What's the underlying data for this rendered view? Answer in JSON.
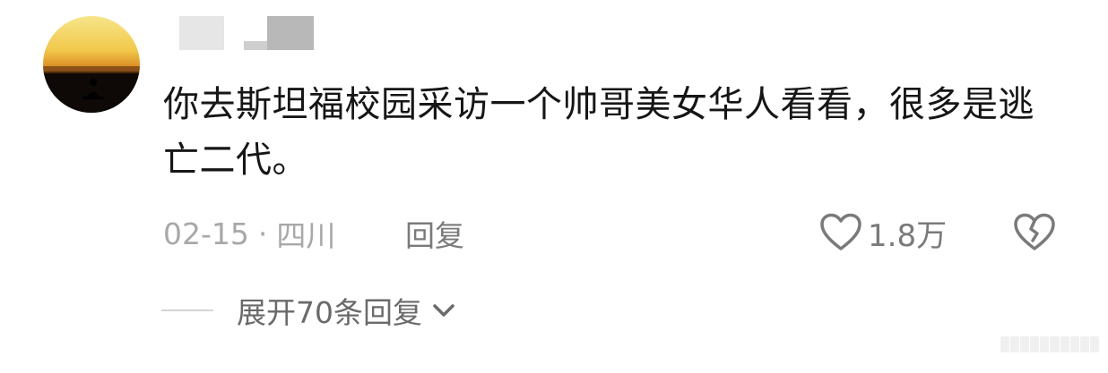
{
  "comment": {
    "text": "你去斯坦福校园采访一个帅哥美女华人看看，很多是逃亡二代。",
    "date": "02-15",
    "separator": "·",
    "location": "四川",
    "reply_label": "回复",
    "like_count": "1.8万",
    "expand_replies_label": "展开70条回复"
  },
  "icons": {
    "avatar": "avatar",
    "like": "heart-icon",
    "dislike": "broken-heart-icon",
    "expand": "chevron-down-icon"
  },
  "colors": {
    "text": "#161616",
    "meta": "#a8a8a8",
    "action": "#7a7a7a"
  }
}
